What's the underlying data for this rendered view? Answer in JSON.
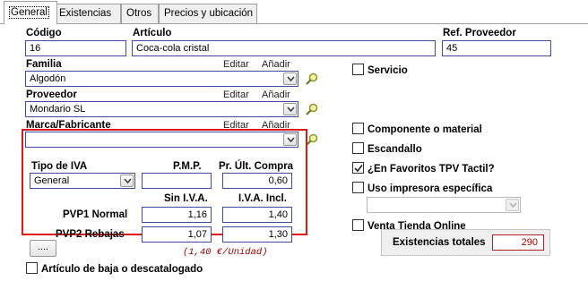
{
  "tabs": [
    {
      "label": "General",
      "active": true
    },
    {
      "label": "Existencias",
      "active": false
    },
    {
      "label": "Otros",
      "active": false
    },
    {
      "label": "Precios y ubicación",
      "active": false
    }
  ],
  "codigo": {
    "label": "Código",
    "value": "16"
  },
  "articulo": {
    "label": "Artículo",
    "value": "Coca-cola cristal"
  },
  "ref_proveedor": {
    "label": "Ref. Proveedor",
    "value": "45"
  },
  "familia": {
    "label": "Familia",
    "value": "Algodón",
    "edit_label": "Editar",
    "add_label": "Añadir"
  },
  "proveedor": {
    "label": "Proveedor",
    "value": "Mondario SL",
    "edit_label": "Editar",
    "add_label": "Añadir"
  },
  "marca": {
    "label": "Marca/Fabricante",
    "value": "",
    "edit_label": "Editar",
    "add_label": "Añadir"
  },
  "pricing": {
    "tipo_iva_label": "Tipo de IVA",
    "tipo_iva_value": "General",
    "pmp_label": "P.M.P.",
    "pmp_value": "",
    "ult_compra_label": "Pr. Últ. Compra",
    "ult_compra_value": "0,60",
    "sin_iva_label": "Sin I.V.A.",
    "iva_incl_label": "I.V.A. Incl.",
    "pvp1_label": "PVP1 Normal",
    "pvp1_sin_iva": "1,16",
    "pvp1_iva_incl": "1,40",
    "pvp2_label": "PVP2 Rebajas",
    "pvp2_sin_iva": "1,07",
    "pvp2_iva_incl": "1,30",
    "more_button": "....",
    "unit_note": "(1,40 €/Unidad)"
  },
  "checkboxes": {
    "servicio": {
      "label": "Servicio",
      "checked": false
    },
    "componente": {
      "label": "Componente o material",
      "checked": false
    },
    "escandallo": {
      "label": "Escandallo",
      "checked": false
    },
    "favoritos": {
      "label": "¿En Favoritos TPV Tactil?",
      "checked": true
    },
    "impresora": {
      "label": "Uso impresora específica",
      "checked": false
    },
    "venta_online": {
      "label": "Venta Tienda Online",
      "checked": false
    },
    "baja": {
      "label": "Artículo de baja o descatalogado",
      "checked": false
    }
  },
  "impresora_select": {
    "value": ""
  },
  "existencias": {
    "label": "Existencias totales",
    "value": "290"
  },
  "colors": {
    "field_border": "#3d4c9e",
    "highlight_border": "#e01818",
    "stock_text": "#a00000"
  },
  "icons": {
    "lookup": "search-icon",
    "dropdown": "chevron-down-icon",
    "check": "check-icon"
  }
}
